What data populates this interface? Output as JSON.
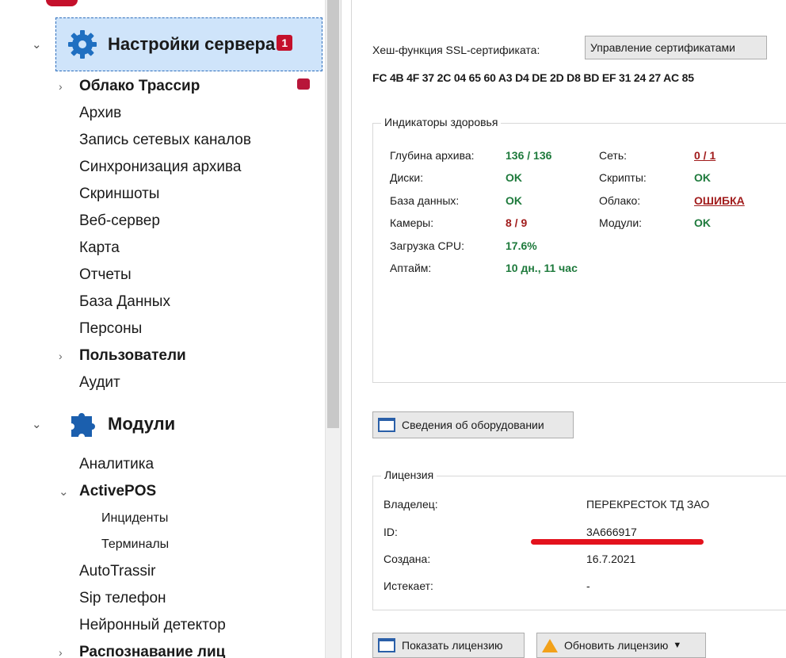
{
  "tree": {
    "server_settings": {
      "label": "Настройки сервера",
      "badge": "1"
    },
    "server_children": [
      {
        "label": "Облако Трассир",
        "bold": true,
        "expandable": true
      },
      {
        "label": "Архив"
      },
      {
        "label": "Запись сетевых каналов"
      },
      {
        "label": "Синхронизация архива"
      },
      {
        "label": "Скриншоты"
      },
      {
        "label": "Веб-сервер"
      },
      {
        "label": "Карта"
      },
      {
        "label": "Отчеты"
      },
      {
        "label": "База Данных"
      },
      {
        "label": "Персоны"
      },
      {
        "label": "Пользователи",
        "bold": true,
        "expandable": true
      },
      {
        "label": "Аудит"
      }
    ],
    "modules": {
      "label": "Модули"
    },
    "module_children": [
      {
        "label": "Аналитика"
      },
      {
        "label": "ActivePOS",
        "bold": true,
        "expanded": true
      },
      {
        "label": "Инциденты",
        "sub": true
      },
      {
        "label": "Терминалы",
        "sub": true
      },
      {
        "label": "AutoTrassir"
      },
      {
        "label": "Sip телефон"
      },
      {
        "label": "Нейронный детектор"
      },
      {
        "label": "Распознавание лиц",
        "bold": true,
        "expandable": true
      }
    ],
    "colors": {
      "selection": "#cfe4fa",
      "badge": "#c4102b",
      "gear": "#1f6fc1"
    }
  },
  "ssl": {
    "label": "Хеш-функция SSL-сертификата:",
    "manage_button": "Управление сертификатами",
    "hash": "FC 4B 4F 37 2C 04 65 60 A3 D4 DE 2D D8 BD EF 31 24 27 AC 85"
  },
  "health": {
    "title": "Индикаторы здоровья",
    "left": [
      {
        "key": "Глубина архива:",
        "value": "136 / 136",
        "status": "ok"
      },
      {
        "key": "Диски:",
        "value": "OK",
        "status": "ok"
      },
      {
        "key": "База данных:",
        "value": "OK",
        "status": "ok"
      },
      {
        "key": "Камеры:",
        "value": "8 / 9",
        "status": "bad"
      },
      {
        "key": "Загрузка CPU:",
        "value": "17.6%",
        "status": "ok"
      },
      {
        "key": "Аптайм:",
        "value": "10 дн., 11 час",
        "status": "ok"
      }
    ],
    "right": [
      {
        "key": "Сеть:",
        "value": "0 / 1",
        "status": "bad",
        "link": true
      },
      {
        "key": "Скрипты:",
        "value": "OK",
        "status": "ok"
      },
      {
        "key": "Облако:",
        "value": "ОШИБКА",
        "status": "bad",
        "link": true
      },
      {
        "key": "Модули:",
        "value": "OK",
        "status": "ok"
      }
    ],
    "colors": {
      "ok": "#1e7a3c",
      "bad": "#a11c1c"
    }
  },
  "hardware_button": "Сведения об оборудовании",
  "license": {
    "title": "Лицензия",
    "rows": [
      {
        "key": "Владелец:",
        "value": "ПЕРЕКРЕСТОК ТД ЗАО"
      },
      {
        "key": "ID:",
        "value": "3A666917"
      },
      {
        "key": "Создана:",
        "value": "16.7.2021"
      },
      {
        "key": "Истекает:",
        "value": "-"
      }
    ]
  },
  "bottom_buttons": {
    "show_license": "Показать лицензию",
    "update_license": "Обновить лицензию"
  }
}
